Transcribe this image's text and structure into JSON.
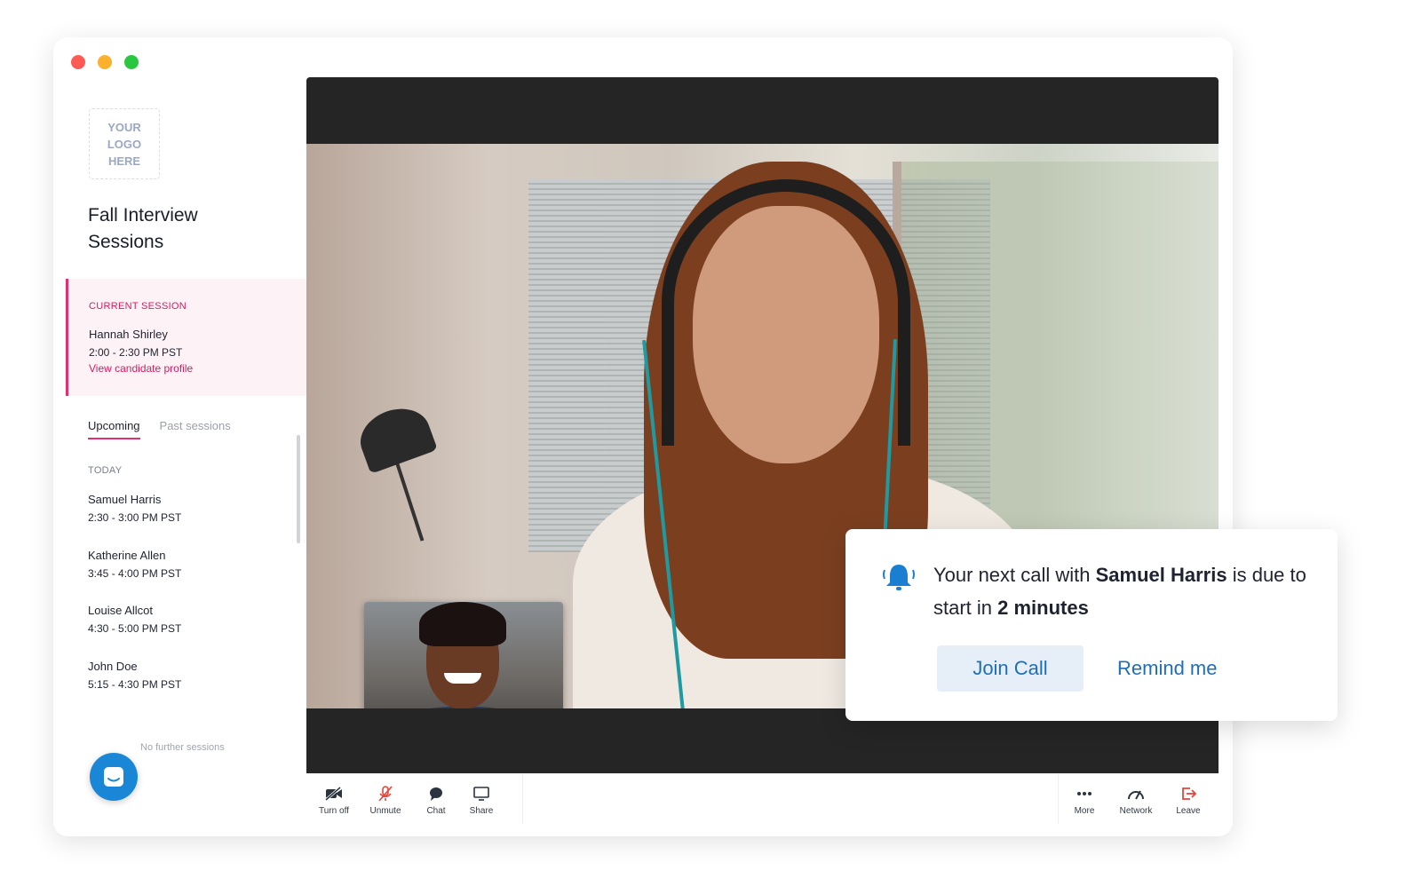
{
  "sidebar": {
    "logo_lines": [
      "YOUR",
      "LOGO",
      "HERE"
    ],
    "title": "Fall Interview Sessions",
    "current_session": {
      "label": "CURRENT SESSION",
      "name": "Hannah Shirley",
      "time": "2:00 - 2:30 PM PST",
      "link": "View candidate profile"
    },
    "tabs": [
      {
        "label": "Upcoming",
        "active": true
      },
      {
        "label": "Past sessions",
        "active": false
      }
    ],
    "today_label": "TODAY",
    "sessions": [
      {
        "name": "Samuel Harris",
        "time": "2:30 - 3:00 PM PST"
      },
      {
        "name": "Katherine Allen",
        "time": "3:45 - 4:00 PM PST"
      },
      {
        "name": "Louise Allcot",
        "time": "4:30 - 5:00 PM PST"
      },
      {
        "name": "John Doe",
        "time": "5:15 - 4:30 PM PST"
      }
    ],
    "no_further": "No further sessions"
  },
  "toolbar": {
    "left": [
      {
        "label": "Turn off",
        "icon": "video-off-icon"
      },
      {
        "label": "Unmute",
        "icon": "mic-off-icon"
      },
      {
        "label": "Chat",
        "icon": "chat-bubble-icon"
      },
      {
        "label": "Share",
        "icon": "screen-share-icon"
      }
    ],
    "right": [
      {
        "label": "More",
        "icon": "more-icon"
      },
      {
        "label": "Network",
        "icon": "network-gauge-icon"
      },
      {
        "label": "Leave",
        "icon": "leave-icon"
      }
    ]
  },
  "notification": {
    "text_prefix": "Your next call with ",
    "person": "Samuel Harris",
    "text_mid": " is due to start in ",
    "duration": "2 minutes",
    "join_label": "Join Call",
    "remind_label": "Remind me",
    "icon": "bell-icon"
  },
  "colors": {
    "accent": "#e1306c",
    "link_blue": "#1f6fb8",
    "fab": "#1a87d6"
  }
}
